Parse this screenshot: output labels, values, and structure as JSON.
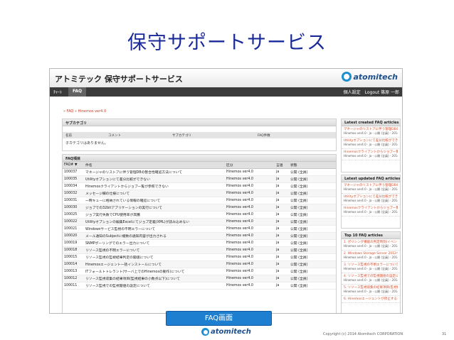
{
  "slide": {
    "title": "保守サポートサービス",
    "caption": "FAQ画面",
    "footer_logo": "atomitech",
    "copyright": "Copyright (c) 2014 Atomitech CORPORATION",
    "page_number": "31"
  },
  "app": {
    "title": "アトミテック 保守サポートサービス",
    "logo": "atomitech",
    "nav": {
      "top": "ﾁｬｰﾄ",
      "faq": "FAQ",
      "settings": "個人設定",
      "logout": "Logout 篠原 一郎"
    },
    "breadcrumb": "» FAQ » Hinemos ver4.0",
    "category": {
      "heading": "サブカテゴリ",
      "columns": [
        "名前",
        "コメント",
        "サブカテゴリ",
        "FAQ件数"
      ],
      "empty_text": "子カテゴリはありません。"
    },
    "faq_list": {
      "heading": "FAQ項目",
      "columns": [
        "FAQ# ▼",
        "件名",
        "区分",
        "言語",
        "状態"
      ],
      "rows": [
        [
          "100037",
          "マネージャのリストアに伴う管理DBの整合性確認方法について",
          "Hinemos ver4.0",
          "ja",
          "公開 (全員)"
        ],
        [
          "100035",
          "Utilityオプションにて差分比較ができない",
          "Hinemos ver4.0",
          "ja",
          "公開 (全員)"
        ],
        [
          "100034",
          "Hinemosクライアントからジョブ一覧が参照できない",
          "Hinemos ver4.0",
          "ja",
          "公開 (全員)"
        ],
        [
          "100032",
          "メッセージ欄の仕様について",
          "Hinemos ver4.0",
          "ja",
          "公開 (全員)"
        ],
        [
          "100031",
          "一時キューに格納されている情報の確認について",
          "Hinemos ver4.0",
          "ja",
          "公開 (全員)"
        ],
        [
          "100030",
          "ジョブでの32bitアプリケーションの実行について",
          "Hinemos ver4.0",
          "ja",
          "公開 (全員)"
        ],
        [
          "100025",
          "ジョブ実行失敗でCPU使用率が高騰",
          "Hinemos ver4.0",
          "ja",
          "公開 (全員)"
        ],
        [
          "100022",
          "Utilityオプションの編集Excelにてジョブ定義(XML)が読み込めない",
          "Hinemos ver4.0",
          "ja",
          "公開 (全員)"
        ],
        [
          "100021",
          "Windowsサービス監視の不明エラーについて",
          "Hinemos ver4.0",
          "ja",
          "公開 (全員)"
        ],
        [
          "100020",
          "メール通知のSubjectに複数の通知内容が出力される",
          "Hinemos ver4.0",
          "ja",
          "公開 (全員)"
        ],
        [
          "100019",
          "SNMPポーリングでのエラー出力について",
          "Hinemos ver4.0",
          "ja",
          "公開 (全員)"
        ],
        [
          "100018",
          "リソース監視の不明エラーについて",
          "Hinemos ver4.0",
          "ja",
          "公開 (全員)"
        ],
        [
          "100015",
          "リソース監視の監視結果判定の閾値について",
          "Hinemos ver4.0",
          "ja",
          "公開 (全員)"
        ],
        [
          "100014",
          "Hinemosエージェント一括インストールについて",
          "Hinemos ver4.0",
          "ja",
          "公開 (全員)"
        ],
        [
          "100013",
          "ITフォールトトレラント(サーバ上でのHinemosの動作)について",
          "Hinemos ver4.0",
          "ja",
          "公開 (全員)"
        ],
        [
          "100012",
          "リソース監視収集の結果項目(監視結果の小数点以下)について",
          "Hinemos ver4.0",
          "ja",
          "公開 (全員)"
        ],
        [
          "100011",
          "リソース監視での監視閾値の設定について",
          "Hinemos ver4.0",
          "ja",
          "公開 (全員)"
        ]
      ]
    },
    "latest_created": {
      "heading": "Latest created FAQ articles",
      "items": [
        {
          "title": "マネージャのリストアに伴う管理DBの整合性確認方法について",
          "meta": "Hinemos ver4.0 - ja - 公開 (全員) - 2014/11/07 13:26"
        },
        {
          "title": "Utilityオプションにて差分比較ができない",
          "meta": "Hinemos ver4.0 - ja - 公開 (全員) - 2014/11/05 23:38"
        },
        {
          "title": "Hinemosクライアントからジョブ一覧が参照できない",
          "meta": "Hinemos ver4.0 - ja - 公開 (全員) - 2014/11/05 23:36"
        }
      ]
    },
    "latest_updated": {
      "heading": "Latest updated FAQ articles",
      "items": [
        {
          "title": "マネージャのリストアに伴う管理DBの整合性確認方法について",
          "meta": "Hinemos ver4.0 - ja - 公開 (全員) - 2014/11/07 13:26"
        },
        {
          "title": "Utilityオプションにて差分比較ができない",
          "meta": "Hinemos ver4.0 - ja - 公開 (全員) - 2014/11/05 23:38"
        },
        {
          "title": "Hinemosクライアントからジョブ一覧が参照できない",
          "meta": "Hinemos ver4.0 - ja - 公開 (全員) - 2014/11/05 23:36"
        }
      ]
    },
    "top10": {
      "heading": "Top 10 FAQ articles",
      "items": [
        {
          "title": "1. ポリシング機能の判定時刻/イベントの出力について",
          "meta": "Hinemos ver4.0 - ja - 公開 (全員) - 2014/10/08 14:26"
        },
        {
          "title": "2. Windows Storage Server 2012へのHinemosエージェント対応可否",
          "meta": "Hinemos ver4.0 - ja - 公開 (全員) - 2014/10/08 23:02"
        },
        {
          "title": "3. リソース監視の不明エラーについて",
          "meta": "Hinemos ver4.0 - ja - 公開 (全員) - 2014/10/20 17:20"
        },
        {
          "title": "4. リソース監視での監視閾値の設定について",
          "meta": "Hinemos ver4.0 - ja - 公開 (全員) - 2014/10/08 14:13"
        },
        {
          "title": "5. リソース監視収集の結果項目(監視結果の小数点以下)について",
          "meta": "Hinemos ver4.0 - ja - 公開 (全員) - 2014/10/08 23:39"
        },
        {
          "title": "6. Hinemosエージェントが停止すると(ハートビートログの…",
          "meta": ""
        }
      ]
    }
  }
}
